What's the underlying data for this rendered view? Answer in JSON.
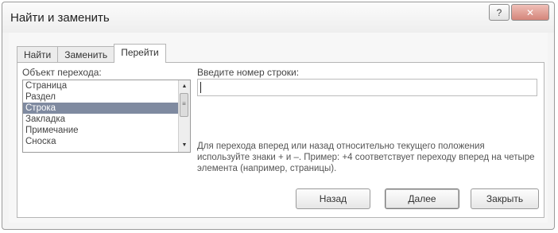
{
  "window": {
    "title": "Найти и заменить"
  },
  "tabs": [
    {
      "label": "Найти",
      "accel": "Н"
    },
    {
      "label": "Заменить",
      "accel": "З"
    },
    {
      "label": "Перейти",
      "accel": "П"
    }
  ],
  "goto": {
    "object_label": "Объект перехода:",
    "objects": [
      "Страница",
      "Раздел",
      "Строка",
      "Закладка",
      "Примечание",
      "Сноска"
    ],
    "selected_object": "Строка",
    "input_label": "Введите номер строки:",
    "input_value": "",
    "hint": "Для перехода вперед или назад относительно текущего положения используйте знаки + и –. Пример: +4 соответствует переходу вперед на четыре элемента (например, страницы)."
  },
  "buttons": {
    "back": "Назад",
    "next": "Далее",
    "close": "Закрыть"
  },
  "icons": {
    "help": "help-icon",
    "close": "close-icon"
  }
}
